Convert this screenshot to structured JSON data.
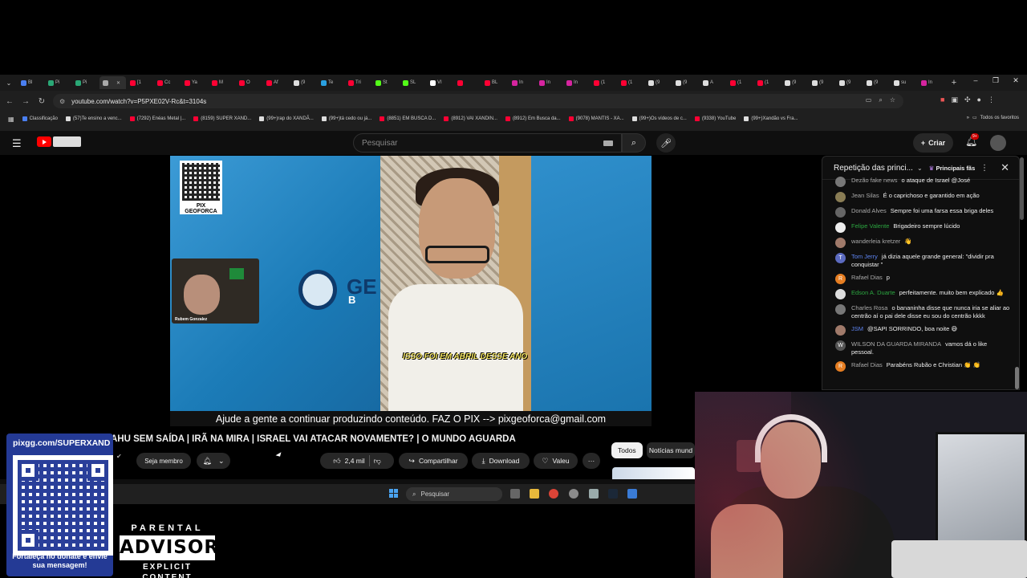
{
  "browser": {
    "tabs": [
      {
        "label": "Bl",
        "color": "#4a7ff0"
      },
      {
        "label": "Pi",
        "color": "#2aa876"
      },
      {
        "label": "Pi",
        "color": "#2aa876"
      },
      {
        "label": "",
        "color": "#aaaaaa",
        "active": true
      },
      {
        "label": "[1",
        "color": "#ff0033"
      },
      {
        "label": "Cc",
        "color": "#ff0033"
      },
      {
        "label": "Ya",
        "color": "#ff0033"
      },
      {
        "label": "M",
        "color": "#ff0033"
      },
      {
        "label": "O",
        "color": "#ff0033"
      },
      {
        "label": "Af",
        "color": "#ff0033"
      },
      {
        "label": "(9",
        "color": "#dddddd"
      },
      {
        "label": "Te",
        "color": "#2aa0e0"
      },
      {
        "label": "Tri",
        "color": "#ff0033"
      },
      {
        "label": "St",
        "color": "#53fc18"
      },
      {
        "label": "SL",
        "color": "#53fc18"
      },
      {
        "label": "VI",
        "color": "#ffffff"
      },
      {
        "label": "",
        "color": "#ff0033"
      },
      {
        "label": "BL",
        "color": "#ff0033"
      },
      {
        "label": "In",
        "color": "#d6249f"
      },
      {
        "label": "In",
        "color": "#d6249f"
      },
      {
        "label": "In",
        "color": "#d6249f"
      },
      {
        "label": "(1",
        "color": "#ff0033"
      },
      {
        "label": "(1",
        "color": "#ff0033"
      },
      {
        "label": "(9",
        "color": "#dddddd"
      },
      {
        "label": "(9",
        "color": "#dddddd"
      },
      {
        "label": "A",
        "color": "#dddddd"
      },
      {
        "label": "(1",
        "color": "#ff0033"
      },
      {
        "label": "(1",
        "color": "#ff0033"
      },
      {
        "label": "(9",
        "color": "#dddddd"
      },
      {
        "label": "(9",
        "color": "#dddddd"
      },
      {
        "label": "(9",
        "color": "#dddddd"
      },
      {
        "label": "(9",
        "color": "#dddddd"
      },
      {
        "label": "su",
        "color": "#dddddd"
      },
      {
        "label": "In",
        "color": "#d6249f"
      }
    ],
    "url": "youtube.com/watch?v=P5PXE02V-Rc&t=3104s",
    "bookmarks": [
      {
        "label": "Classificação",
        "color": "#4a7ff0"
      },
      {
        "label": "(57)Te ensino a venc...",
        "color": "#dddddd"
      },
      {
        "label": "(7292) Enéas Metal |...",
        "color": "#ff0033"
      },
      {
        "label": "(8159) SUPER XAND...",
        "color": "#ff0033"
      },
      {
        "label": "(99+)rap do XANDÃ...",
        "color": "#dddddd"
      },
      {
        "label": "(99+)tá cedo ou já...",
        "color": "#dddddd"
      },
      {
        "label": "(8851) EM BUSCA D...",
        "color": "#ff0033"
      },
      {
        "label": "(8912) VAI XANDIN...",
        "color": "#ff0033"
      },
      {
        "label": "(8912) Em Busca da...",
        "color": "#ff0033"
      },
      {
        "label": "(9078) MANTIS - XA...",
        "color": "#ff0033"
      },
      {
        "label": "(99+)Os vídeos de c...",
        "color": "#dddddd"
      },
      {
        "label": "(9338) YouTube",
        "color": "#ff0033"
      },
      {
        "label": "(99+)Xandão vs Fra...",
        "color": "#dddddd"
      }
    ],
    "all_favorites": "Todos os favoritos"
  },
  "youtube": {
    "search_placeholder": "Pesquisar",
    "create_label": "Criar",
    "notifications_badge": "9+",
    "video": {
      "qr_caption": "PIX GEOFORCA",
      "inset_name": "Rubem Gonzalez",
      "logo_text": "GE",
      "logo_sub": "B",
      "burned_caption": "ISSO FOI EM ABRIL DESSE ANO",
      "banner": "Ajude a gente a continuar produzindo conteúdo. FAZ O PIX --> pixgeoforca@gmail.com"
    },
    "title": "AHU SEM SAÍDA | IRÃ NA MIRA | ISRAEL VAI ATACAR NOVAMENTE? | O MUNDO AGUARDA",
    "join_label": "Seja membro",
    "like_count": "2,4 mil",
    "share_label": "Compartilhar",
    "download_label": "Download",
    "thanks_label": "Valeu",
    "chips": [
      "Todos",
      "Notícias mund"
    ]
  },
  "chat": {
    "header": "Repetição das princi...",
    "filter": "Principais fãs",
    "messages": [
      {
        "author": "Dezão fake news",
        "text": "o ataque de Israel @José",
        "av": "#777777",
        "role": ""
      },
      {
        "author": "Jean Silas",
        "text": "É o caprichoso e garantido em ação",
        "av": "#8a7d55",
        "role": ""
      },
      {
        "author": "Donald Alves",
        "text": "Sempre foi uma farsa essa briga deles",
        "av": "#666666",
        "role": ""
      },
      {
        "author": "Felipe Valente",
        "text": "Brigadeiro sempre lúcido",
        "av": "#eeeeee",
        "role": "member"
      },
      {
        "author": "wanderleia kretzer",
        "text": "👋",
        "av": "#a07a6a",
        "role": ""
      },
      {
        "author": "Tom Jerry",
        "text": "já dizia aquele grande general: \"dividir pra conquistar \"",
        "av": "#5c6bc0",
        "role": "mod",
        "initial": "T"
      },
      {
        "author": "Rafael Dias",
        "text": "p",
        "av": "#e67e22",
        "role": "",
        "initial": "R"
      },
      {
        "author": "Edson A. Duarte",
        "text": "perfeitamente. muito bem explicado 👍",
        "av": "#dddddd",
        "role": "member"
      },
      {
        "author": "Charles Rosa",
        "text": "o bananinha disse que nunca iria se aliar ao centrão aí o pai dele disse eu sou do centrão kkkk",
        "av": "#777777",
        "role": ""
      },
      {
        "author": "JSM",
        "text": "@SAPI SORRINDO, boa noite 😅",
        "av": "#a07a6a",
        "role": "mod"
      },
      {
        "author": "WILSON DA GUARDA MIRANDA",
        "text": "vamos dá o like pessoal.",
        "av": "#555555",
        "role": "",
        "initial": "W"
      },
      {
        "author": "Rafael Dias",
        "text": "Parabéns Rubão e Christian 👏 👏",
        "av": "#e67e22",
        "role": "",
        "initial": "R"
      }
    ]
  },
  "taskbar": {
    "search_placeholder": "Pesquisar"
  },
  "overlay": {
    "pix_url": "pixgg.com/SUPERXAND",
    "pix_cta": "Fortaleça no donate e envie sua mensagem!",
    "advisory_top": "PARENTAL",
    "advisory_mid": "ADVISORY",
    "advisory_bottom": "EXPLICIT CONTENT"
  }
}
